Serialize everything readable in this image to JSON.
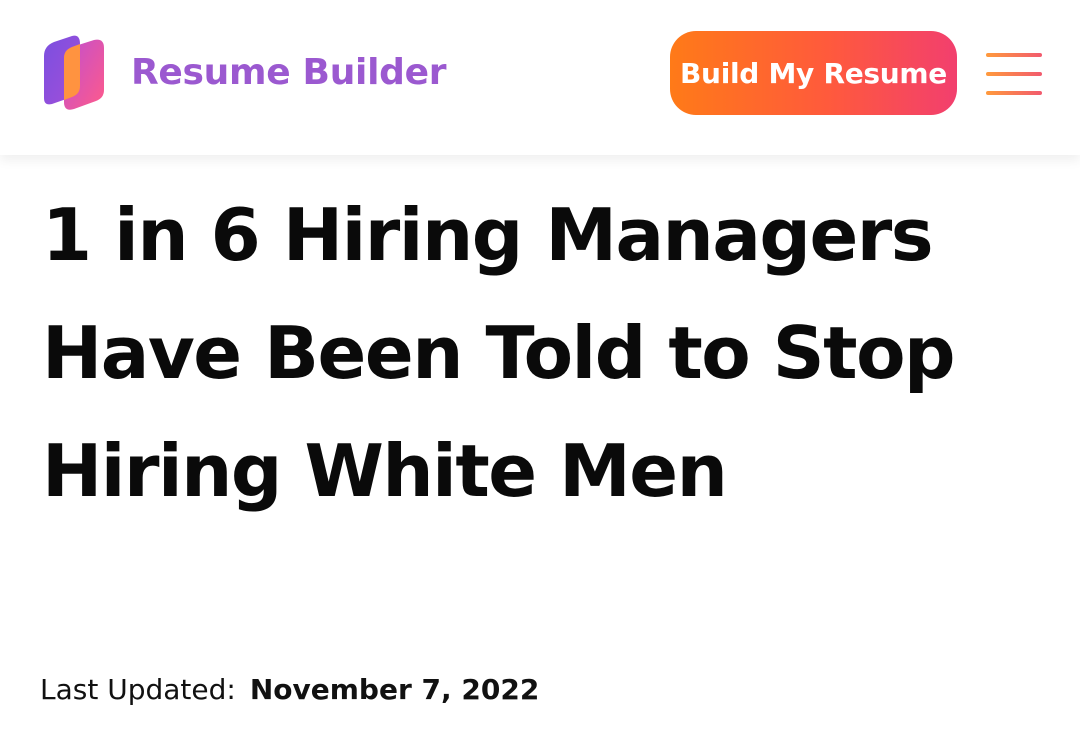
{
  "header": {
    "logo_icon": "resume-builder-logo-icon",
    "brand_name": "Resume Builder",
    "cta_label": "Build My Resume",
    "menu_icon": "hamburger-menu-icon"
  },
  "article": {
    "title": "1 in 6 Hiring Managers Have Been Told to Stop Hiring White Men",
    "last_updated_label": "Last Updated:",
    "last_updated_date": "November 7, 2022"
  },
  "colors": {
    "brand_purple": "#9b59d0",
    "cta_gradient_start": "#ff7a18",
    "cta_gradient_end": "#f23f6e",
    "logo_orange": "#ff9340",
    "text": "#0a0a0a"
  }
}
